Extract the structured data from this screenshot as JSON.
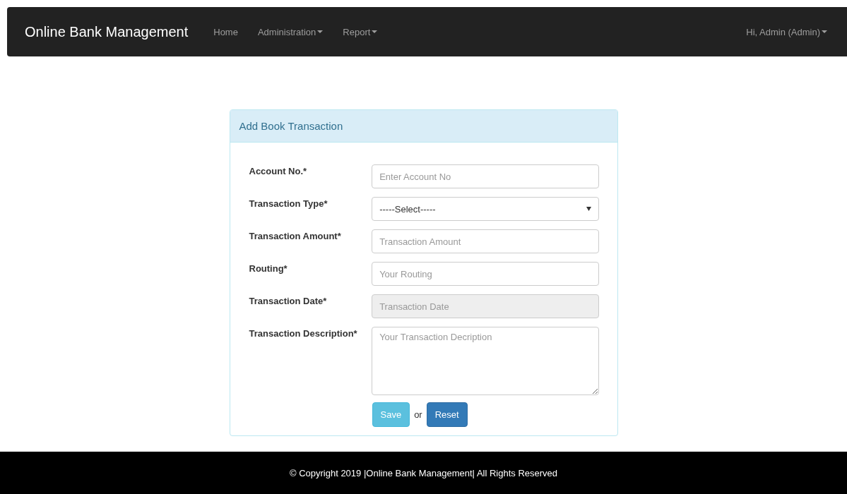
{
  "navbar": {
    "brand": "Online Bank Management",
    "menu": [
      {
        "label": "Home",
        "dropdown": false
      },
      {
        "label": "Administration",
        "dropdown": true
      },
      {
        "label": "Report",
        "dropdown": true
      }
    ],
    "user_menu": {
      "label": "Hi, Admin (Admin)",
      "dropdown": true
    }
  },
  "panel": {
    "title": "Add Book Transaction",
    "fields": [
      {
        "label": "Account No.*",
        "kind": "input",
        "placeholder": "Enter Account No",
        "disabled": false
      },
      {
        "label": "Transaction Type*",
        "kind": "select",
        "value": "-----Select-----",
        "disabled": false
      },
      {
        "label": "Transaction Amount*",
        "kind": "input",
        "placeholder": "Transaction Amount",
        "disabled": false
      },
      {
        "label": "Routing*",
        "kind": "input",
        "placeholder": "Your Routing",
        "disabled": false
      },
      {
        "label": "Transaction Date*",
        "kind": "input",
        "placeholder": "Transaction Date",
        "disabled": true
      },
      {
        "label": "Transaction Description*",
        "kind": "textarea",
        "placeholder": "Your Transaction Decription",
        "disabled": false
      }
    ],
    "save_button": "Save",
    "separator": "or",
    "reset_button": "Reset"
  },
  "footer": "© Copyright 2019 |Online Bank Management| All Rights Reserved"
}
